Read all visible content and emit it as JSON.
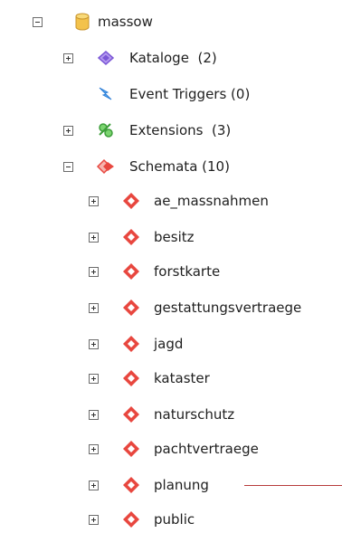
{
  "tree": {
    "database": {
      "label": "massow",
      "icon": "database-icon"
    },
    "catalogs": {
      "label": "Kataloge",
      "count": "(2)",
      "icon": "catalogs-icon"
    },
    "event_triggers": {
      "label": "Event Triggers (0)",
      "icon": "event-triggers-icon"
    },
    "extensions": {
      "label": "Extensions",
      "count": "(3)",
      "icon": "extensions-icon"
    },
    "schemas": {
      "label": "Schemata (10)",
      "icon": "schemas-icon",
      "items": [
        {
          "label": "ae_massnahmen"
        },
        {
          "label": "besitz"
        },
        {
          "label": "forstkarte"
        },
        {
          "label": "gestattungsvertraege"
        },
        {
          "label": "jagd"
        },
        {
          "label": "kataster"
        },
        {
          "label": "naturschutz"
        },
        {
          "label": "pachtvertraege"
        },
        {
          "label": "planung"
        },
        {
          "label": "public"
        }
      ]
    }
  },
  "colors": {
    "schema_icon": "#e8473f",
    "catalog_icon": "#7b57d6",
    "event_icon": "#2f7fd6",
    "extension_icon": "#3e9e3b",
    "database_icon": "#f3c24b"
  }
}
